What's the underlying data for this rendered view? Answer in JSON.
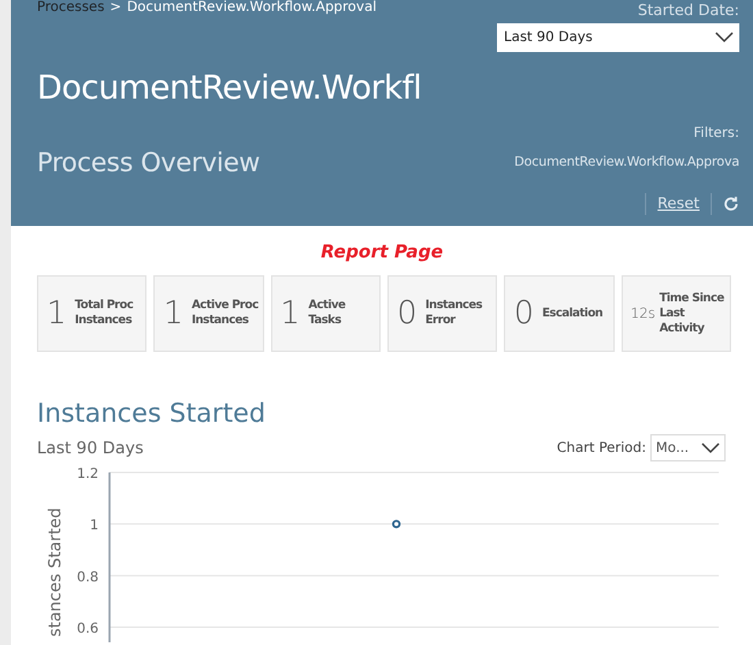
{
  "breadcrumb": {
    "parent": "Processes",
    "separator": ">",
    "current": "DocumentReview.Workflow.Approval"
  },
  "started_date": {
    "label": "Started Date:",
    "value": "Last 90 Days"
  },
  "title": "DocumentReview.Workfl",
  "subtitle": "Process Overview",
  "filters": {
    "label": "Filters:",
    "value": "DocumentReview.Workflow.Approva",
    "reset": "Reset"
  },
  "report_heading": "Report Page",
  "stats": [
    {
      "kind": "big",
      "value": "1",
      "label": "Total Proc Instances"
    },
    {
      "kind": "big",
      "value": "1",
      "label": "Active Proc Instances"
    },
    {
      "kind": "big",
      "value": "1",
      "label": "Active Tasks"
    },
    {
      "kind": "big",
      "value": "0",
      "label": "Instances Error"
    },
    {
      "kind": "big",
      "value": "0",
      "label": "Escalation"
    },
    {
      "kind": "small",
      "value": "12s",
      "label": "Time Since Last Activity"
    }
  ],
  "chart_section": {
    "title": "Instances Started",
    "subtitle": "Last 90 Days",
    "period_label": "Chart Period:",
    "period_value": "Mo...",
    "chart_data": {
      "type": "scatter",
      "ylabel": "stances Started",
      "ylim": [
        0.6,
        1.2
      ],
      "yticks": [
        {
          "value": 0.6,
          "label": "0.6"
        },
        {
          "value": 0.8,
          "label": "0.8"
        },
        {
          "value": 1,
          "label": "1"
        },
        {
          "value": 1.2,
          "label": "1.2"
        }
      ],
      "series": [
        {
          "color": "#2f6690",
          "values": [
            1
          ]
        }
      ]
    }
  }
}
